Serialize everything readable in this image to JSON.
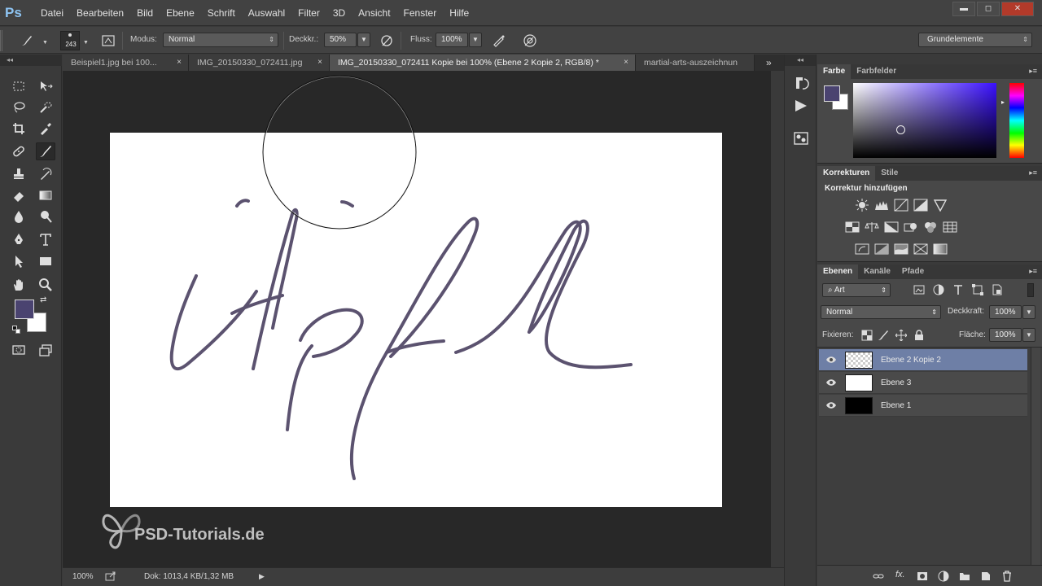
{
  "app": {
    "logo": "Ps"
  },
  "menu": [
    "Datei",
    "Bearbeiten",
    "Bild",
    "Ebene",
    "Schrift",
    "Auswahl",
    "Filter",
    "3D",
    "Ansicht",
    "Fenster",
    "Hilfe"
  ],
  "window_controls": {
    "minimize": "▬",
    "maximize": "◻",
    "close": "✕"
  },
  "options": {
    "brush_size": "243",
    "modus_label": "Modus:",
    "modus_value": "Normal",
    "deckkraft_label": "Deckkr.:",
    "deckkraft_value": "50%",
    "fluss_label": "Fluss:",
    "fluss_value": "100%",
    "workspace_value": "Grundelemente"
  },
  "tabs": [
    {
      "label": "Beispiel1.jpg bei 100..."
    },
    {
      "label": "IMG_20150330_072411.jpg"
    },
    {
      "label": "IMG_20150330_072411 Kopie bei 100% (Ebene 2 Kopie 2, RGB/8) *"
    },
    {
      "label": "martial-arts-auszeichnun"
    }
  ],
  "tab_close": "×",
  "tab_overflow": "»",
  "collapse_left": "◂◂",
  "collapse_right": "▸▸",
  "watermark": {
    "text": "PSD-Tutorials.de"
  },
  "status": {
    "zoom": "100%",
    "doc_info": "Dok: 1013,4 KB/1,32 MB",
    "arrow": "▶"
  },
  "panels": {
    "color": {
      "tabs": [
        "Farbe",
        "Farbfelder"
      ]
    },
    "adjustments": {
      "tabs": [
        "Korrekturen",
        "Stile"
      ],
      "heading": "Korrektur hinzufügen"
    },
    "layers": {
      "tabs": [
        "Ebenen",
        "Kanäle",
        "Pfade"
      ],
      "filter_kind": "Art",
      "blend_mode": "Normal",
      "opacity_label": "Deckkraft:",
      "opacity_value": "100%",
      "lock_label": "Fixieren:",
      "fill_label": "Fläche:",
      "fill_value": "100%",
      "items": [
        {
          "name": "Ebene 2 Kopie 2",
          "selected": true
        },
        {
          "name": "Ebene 3",
          "selected": false
        },
        {
          "name": "Ebene 1",
          "selected": false
        }
      ]
    }
  },
  "colors": {
    "foreground": "#4a4370",
    "background": "#ffffff",
    "selected_layer": "#6e7fa6"
  }
}
